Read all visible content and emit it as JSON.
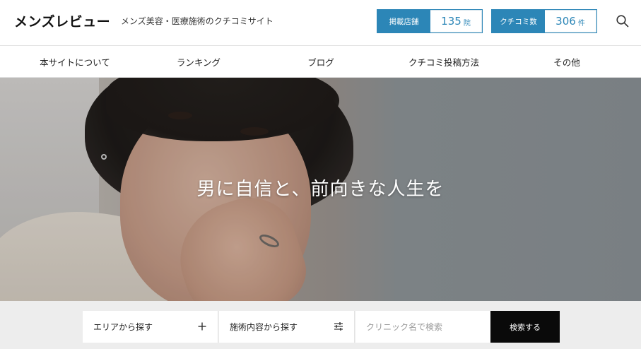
{
  "header": {
    "logo": "メンズレビュー",
    "tagline": "メンズ美容・医療施術のクチコミサイト",
    "stats": [
      {
        "label": "掲載店舗",
        "value": "135",
        "unit": "院"
      },
      {
        "label": "クチコミ数",
        "value": "306",
        "unit": "件"
      }
    ],
    "search_icon": "search-icon"
  },
  "nav": {
    "items": [
      "本サイトについて",
      "ランキング",
      "ブログ",
      "クチコミ投稿方法",
      "その他"
    ]
  },
  "hero": {
    "headline": "男に自信と、前向きな人生を"
  },
  "search": {
    "area_label": "エリアから探す",
    "area_icon": "plus-icon",
    "treatment_label": "施術内容から探す",
    "treatment_icon": "filter-sliders-icon",
    "clinic_placeholder": "クリニック名で検索",
    "submit_label": "検索する"
  },
  "colors": {
    "accent": "#2c86b7",
    "submit_bg": "#0a0a0a",
    "search_area_bg": "#ededed"
  }
}
